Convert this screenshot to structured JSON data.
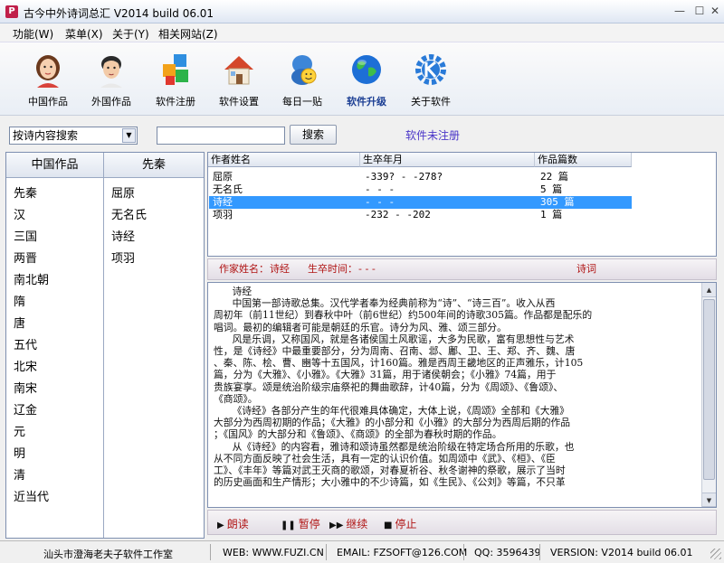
{
  "window": {
    "title": "古今中外诗词总汇 V2014 build 06.01",
    "app_icon_letter": "P",
    "minimize_glyph": "—",
    "maximize_glyph": "☐",
    "close_glyph": "✕"
  },
  "menu": {
    "items": [
      "功能(W)",
      "菜单(X)",
      "关于(Y)",
      "相关网站(Z)"
    ]
  },
  "toolbar": {
    "items": [
      "中国作品",
      "外国作品",
      "软件注册",
      "软件设置",
      "每日一贴",
      "软件升级",
      "关于软件"
    ]
  },
  "search": {
    "mode": "按诗内容搜索",
    "input_value": "",
    "button_label": "搜索",
    "registration_status": "软件未注册"
  },
  "category_panel": {
    "header": "中国作品",
    "items": [
      "先秦",
      "汉",
      "三国",
      "两晋",
      "南北朝",
      "隋",
      "唐",
      "五代",
      "北宋",
      "南宋",
      "辽金",
      "元",
      "明",
      "清",
      "近当代"
    ]
  },
  "author_panel": {
    "header": "先秦",
    "items": [
      "屈原",
      "无名氏",
      "诗经",
      "项羽"
    ]
  },
  "author_table": {
    "headers": [
      "作者姓名",
      "生卒年月",
      "作品篇数"
    ],
    "rows": [
      [
        "屈原",
        "-339? - -278?",
        "22 篇"
      ],
      [
        "无名氏",
        "- - -",
        "5 篇"
      ],
      [
        "诗经",
        "- - -",
        "305 篇"
      ],
      [
        "项羽",
        "-232 - -202",
        "1 篇"
      ]
    ],
    "selected_row": 2
  },
  "info_bar": {
    "author_label": "作家姓名：",
    "author_value": "诗经",
    "time_label": "生卒时间：",
    "time_value": "- - -",
    "link": "诗词"
  },
  "content": {
    "text": "      诗经\n      中国第一部诗歌总集。汉代学者奉为经典前称为“诗”、“诗三百”。收入从西\n周初年（前11世纪）到春秋中叶（前6世纪）约500年间的诗歌305篇。作品都是配乐的\n唱词。最初的编辑者可能是朝廷的乐官。诗分为风、雅、颂三部分。\n      风是乐调，又称国风，就是各诸侯国土风歌谣，大多为民歌，富有思想性与艺术\n性，是《诗经》中最重要部分，分为周南、召南、邶、鄘、卫、王、郑、齐、魏、唐\n、秦、陈、桧、曹、豳等十五国风，计160篇。雅是西周王畿地区的正声雅乐，计105\n篇，分为《大雅》、《小雅》。《大雅》31篇，用于诸侯朝会；《小雅》74篇，用于\n贵族宴享。颂是统治阶级宗庙祭祀的舞曲歌辞，计40篇，分为《周颂》、《鲁颂》、\n《商颂》。\n      《诗经》各部分产生的年代很难具体确定，大体上说，《周颂》全部和《大雅》\n大部分为西周初期的作品；《大雅》的小部分和《小雅》的大部分为西周后期的作品\n；《国风》的大部分和《鲁颂》、《商颂》的全部为春秋时期的作品。\n      从《诗经》的内容看，雅诗和颂诗虽然都是统治阶级在特定场合所用的乐歌，也\n从不同方面反映了社会生活，具有一定的认识价值。如周颂中《武》、《桓》、《臣\n工》、《丰年》等篇对武王灭商的歌颂，对春夏祈谷、秋冬谢神的祭歌，展示了当时\n的历史画面和生产情形；大小雅中的不少诗篇，如《生民》、《公刘》等篇，不只革"
  },
  "playback": {
    "read": "朗读",
    "pause": "暂停",
    "resume": "继续",
    "stop": "停止"
  },
  "status_bar": {
    "studio": "汕头市澄海老夫子软件工作室",
    "web": "WEB: WWW.FUZI.CN",
    "email": "EMAIL: FZSOFT@126.COM",
    "qq": "QQ: 3596439",
    "version": "VERSION: V2014 build 06.01"
  },
  "colors": {
    "selection": "#3399ff",
    "info_red": "#b01414",
    "status_purple": "#4a35c8"
  }
}
